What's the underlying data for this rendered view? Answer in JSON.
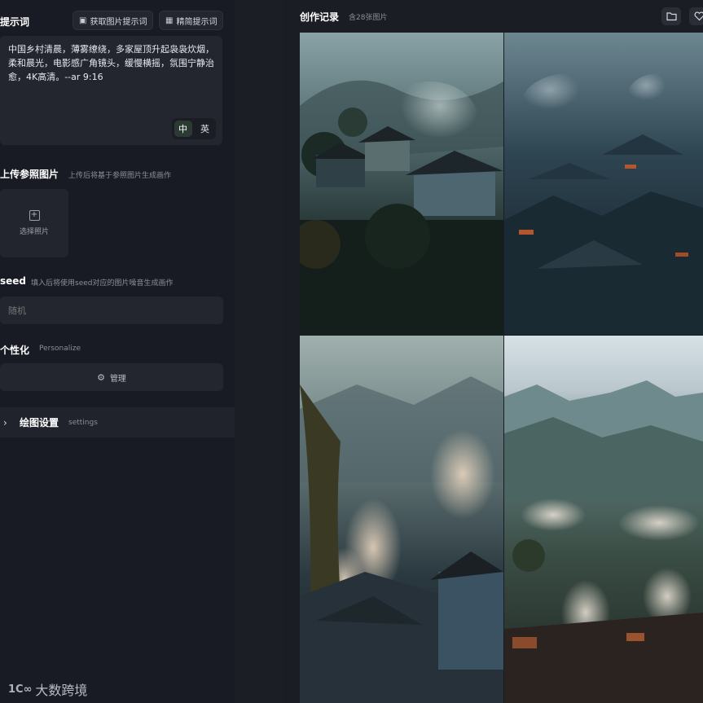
{
  "prompt": {
    "title": "提示词",
    "get_prompt_btn": "获取图片提示词",
    "refine_prompt_btn": "精简提示词",
    "text": "中国乡村清晨，薄雾缭绕，多家屋顶升起袅袅炊烟，柔和晨光，电影感广角镜头，缓慢横摇，氛围宁静治愈，4K高清。--ar 9:16",
    "lang_zh": "中",
    "lang_en": "英"
  },
  "upload": {
    "title": "上传参照图片",
    "subtitle": "上传后将基于参照图片生成画作",
    "button_label": "选择照片"
  },
  "seed": {
    "title": "seed",
    "subtitle": "填入后将使用seed对应的图片噪音生成画作",
    "placeholder": "随机"
  },
  "personalize": {
    "title": "个性化",
    "subtitle": "Personalize",
    "manage_label": "管理"
  },
  "drawing_settings": {
    "title": "绘图设置",
    "subtitle": "settings"
  },
  "records": {
    "title": "创作记录",
    "count": "含28张图片"
  },
  "watermark": {
    "text": "大数跨境",
    "mark": "1C∞"
  },
  "icons": {
    "folder": "folder-icon",
    "heart": "heart-icon",
    "image": "image-icon",
    "plus": "plus-icon",
    "manage": "settings-icon",
    "chevron": "chevron-right-icon"
  },
  "colors": {
    "background": "#151820",
    "panel": "#23262f",
    "accent_active": "#2c3a34"
  }
}
